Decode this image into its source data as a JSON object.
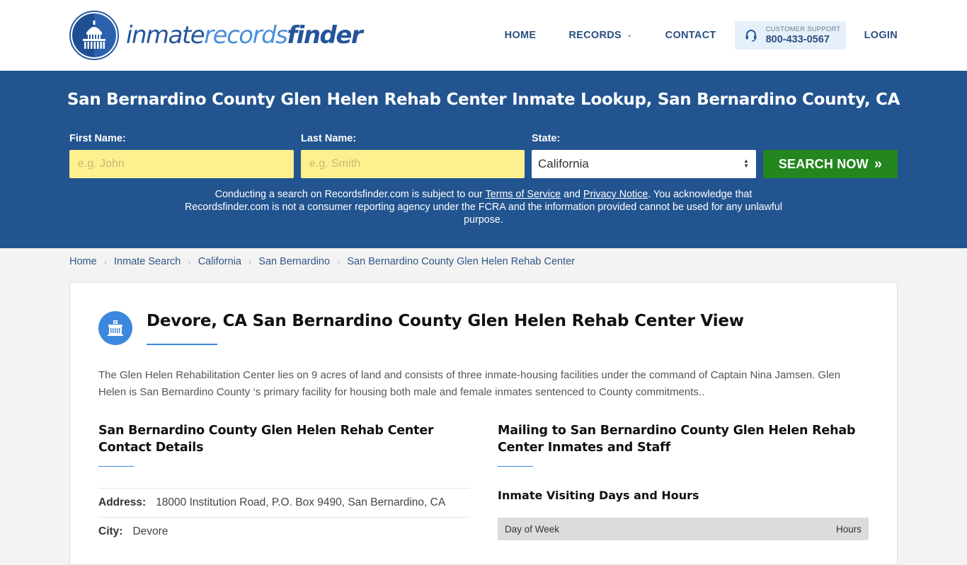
{
  "header": {
    "logo": {
      "part1": "inmate",
      "part2": "records",
      "part3": "finder"
    },
    "nav": {
      "home": "HOME",
      "records": "RECORDS",
      "contact": "CONTACT",
      "support_label": "CUSTOMER SUPPORT",
      "support_phone": "800-433-0567",
      "login": "LOGIN"
    }
  },
  "hero": {
    "title": "San Bernardino County Glen Helen Rehab Center Inmate Lookup, San Bernardino County, CA",
    "first_name_label": "First Name:",
    "first_name_placeholder": "e.g. John",
    "last_name_label": "Last Name:",
    "last_name_placeholder": "e.g. Smith",
    "state_label": "State:",
    "state_value": "California",
    "search_button": "SEARCH NOW",
    "disclaimer_before": "Conducting a search on Recordsfinder.com is subject to our ",
    "terms_link": "Terms of Service",
    "disclaimer_and": " and ",
    "privacy_link": "Privacy Notice",
    "disclaimer_after": ". You acknowledge that Recordsfinder.com is not a consumer reporting agency under the FCRA and the information provided cannot be used for any unlawful purpose."
  },
  "breadcrumb": [
    "Home",
    "Inmate Search",
    "California",
    "San Bernardino",
    "San Bernardino County Glen Helen Rehab Center"
  ],
  "main": {
    "title": "Devore, CA San Bernardino County Glen Helen Rehab Center View",
    "intro": "The Glen Helen Rehabilitation Center lies on 9 acres of land and consists of three inmate-housing facilities under the command of Captain Nina Jamsen. Glen Helen is San Bernardino County ‘s primary facility for housing both male and female inmates sentenced to County commitments..",
    "contact": {
      "title": "San Bernardino County Glen Helen Rehab Center Contact Details",
      "rows": [
        {
          "key": "Address:",
          "value": "18000 Institution Road, P.O. Box 9490, San Bernardino, CA"
        },
        {
          "key": "City:",
          "value": "Devore"
        }
      ]
    },
    "mailing": {
      "title": "Mailing to San Bernardino County Glen Helen Rehab Center Inmates and Staff",
      "visiting_title": "Inmate Visiting Days and Hours",
      "table_headers": [
        "Day of Week",
        "Hours"
      ]
    }
  },
  "colors": {
    "hero_bg": "#22548f",
    "search_green": "#23861f",
    "input_yellow": "#fff08f",
    "accent_blue": "#3c88dd",
    "nav_text": "#2b4f7e"
  }
}
